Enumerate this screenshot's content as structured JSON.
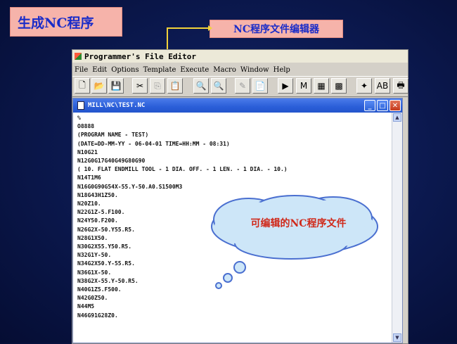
{
  "slide": {
    "title": "生成NC程序",
    "editor_label": "NC程序文件编辑器",
    "callout": "可编辑的NC程序文件"
  },
  "app": {
    "title": "Programmer's File Editor",
    "menu": [
      "File",
      "Edit",
      "Options",
      "Template",
      "Execute",
      "Macro",
      "Window",
      "Help"
    ]
  },
  "toolbar": {
    "buttons": [
      {
        "name": "new-file-icon",
        "glyph": "🗋"
      },
      {
        "name": "open-folder-icon",
        "glyph": "📂"
      },
      {
        "name": "save-disk-icon",
        "glyph": "💾"
      },
      {
        "name": "cut-scissors-icon",
        "glyph": "✂"
      },
      {
        "name": "copy-icon",
        "glyph": "⎘"
      },
      {
        "name": "paste-icon",
        "glyph": "📋"
      },
      {
        "name": "find-icon",
        "glyph": "🔍"
      },
      {
        "name": "find-next-icon",
        "glyph": "🔍"
      },
      {
        "name": "replace-icon",
        "glyph": "✎"
      },
      {
        "name": "document-icon",
        "glyph": "📄"
      },
      {
        "name": "execute-icon",
        "glyph": "▶"
      },
      {
        "name": "dos-icon",
        "glyph": "M"
      },
      {
        "name": "window-icon",
        "glyph": "▦"
      },
      {
        "name": "macro-icon",
        "glyph": "▩"
      },
      {
        "name": "tools-icon",
        "glyph": "✦"
      },
      {
        "name": "sort-ab-icon",
        "glyph": "AB"
      },
      {
        "name": "print-icon",
        "glyph": "🖶"
      }
    ]
  },
  "document": {
    "title": "MILL\\NC\\TEST.NC",
    "lines": [
      "%",
      "O8888",
      "(PROGRAM NAME - TEST)",
      "(DATE=DD-MM-YY - 06-04-01 TIME=HH:MM - 08:31)",
      "N10G21",
      "N12G0G17G40G49G80G90",
      "( 10. FLAT ENDMILL TOOL - 1 DIA. OFF. - 1 LEN. - 1 DIA. - 10.)",
      "N14T1M6",
      "N16G0G90G54X-55.Y-50.A0.S1500M3",
      "N18G43H1Z50.",
      "N20Z10.",
      "N22G1Z-5.F100.",
      "N24Y50.F200.",
      "N26G2X-50.Y55.R5.",
      "N28G1X50.",
      "N30G2X55.Y50.R5.",
      "N32G1Y-50.",
      "N34G2X50.Y-55.R5.",
      "N36G1X-50.",
      "N38G2X-55.Y-50.R5.",
      "N40G1Z5.F500.",
      "N42G0Z50.",
      "N44M5",
      "N46G91G28Z0."
    ]
  },
  "colors": {
    "background": "#0c1a52",
    "label_box": "#f6b3aa",
    "label_text": "#1a2cc8",
    "callout_text": "#d0291a",
    "doc_titlebar": "#2a5ed8"
  }
}
